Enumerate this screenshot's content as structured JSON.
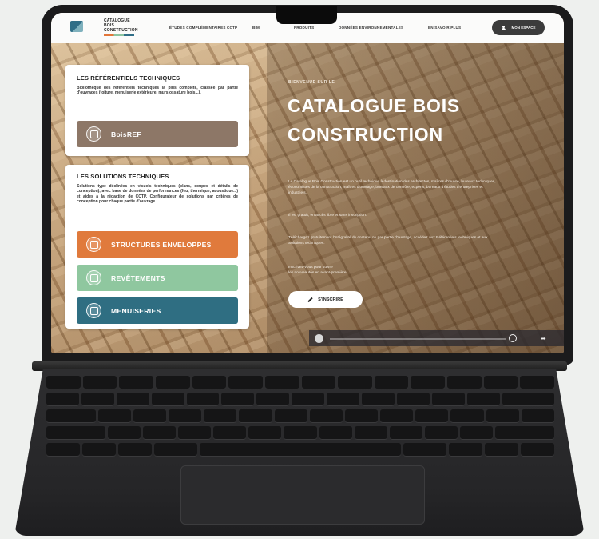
{
  "nav": {
    "items": [
      "ÉTUDES COMPLÉMENTAIRES",
      "CCTP",
      "BIM",
      "PRODUITS",
      "DONNÉES ENVIRONNEMENTALES",
      "EN SAVOIR PLUS"
    ],
    "account_label": "MON ESPACE",
    "logo_lines": [
      "CATALOGUE",
      "BOIS",
      "CONSTRUCTION"
    ]
  },
  "referentiels": {
    "title": "LES RÉFÉRENTIELS TECHNIQUES",
    "desc": "Bibliothèque des référentiels techniques la plus complète, classée par partie d'ouvrages (toiture, menuiserie extérieure, murs ossature bois...).",
    "button": "BoisREF"
  },
  "solutions": {
    "title": "LES SOLUTIONS TECHNIQUES",
    "desc": "Solutions type déclinées en visuels techniques (plans, coupes et détails de conception), avec base de données de performances (feu, thermique, acoustique...) et aides à la rédaction de CCTP. Configurateur de solutions par critères de conception pour chaque partie d'ouvrage.",
    "buttons": [
      "STRUCTURES ENVELOPPES",
      "REVÊTEMENTS",
      "MENUISERIES"
    ]
  },
  "hero": {
    "kicker": "BIENVENUE SUR LE",
    "title_line1": "CATALOGUE BOIS",
    "title_line2": "CONSTRUCTION",
    "para1": "Le Catalogue Bois Construction est un outil technique à destination des architectes, maîtres d'œuvre, bureaux techniques, économistes de la construction, maîtres d'ouvrage, bureaux de contrôle, experts, bureaux d'études d'entreprises et industriels.",
    "para2": "Il est gratuit, en accès libre et sans inscription.",
    "para3": "Téléchargez gratuitement l'intégralité du contenu ou par partie d'ouvrage, accédez aux Référentiels techniques et aux Solutions techniques.",
    "para4a": "Inscrivez-vous pour suivre",
    "para4b": "les nouveautés en avant-première",
    "cta": "S'INSCRIRE"
  },
  "colors": {
    "orange": "#e07a3c",
    "green": "#8fc79f",
    "teal": "#2f6e82",
    "boisref": "#8d7767"
  }
}
